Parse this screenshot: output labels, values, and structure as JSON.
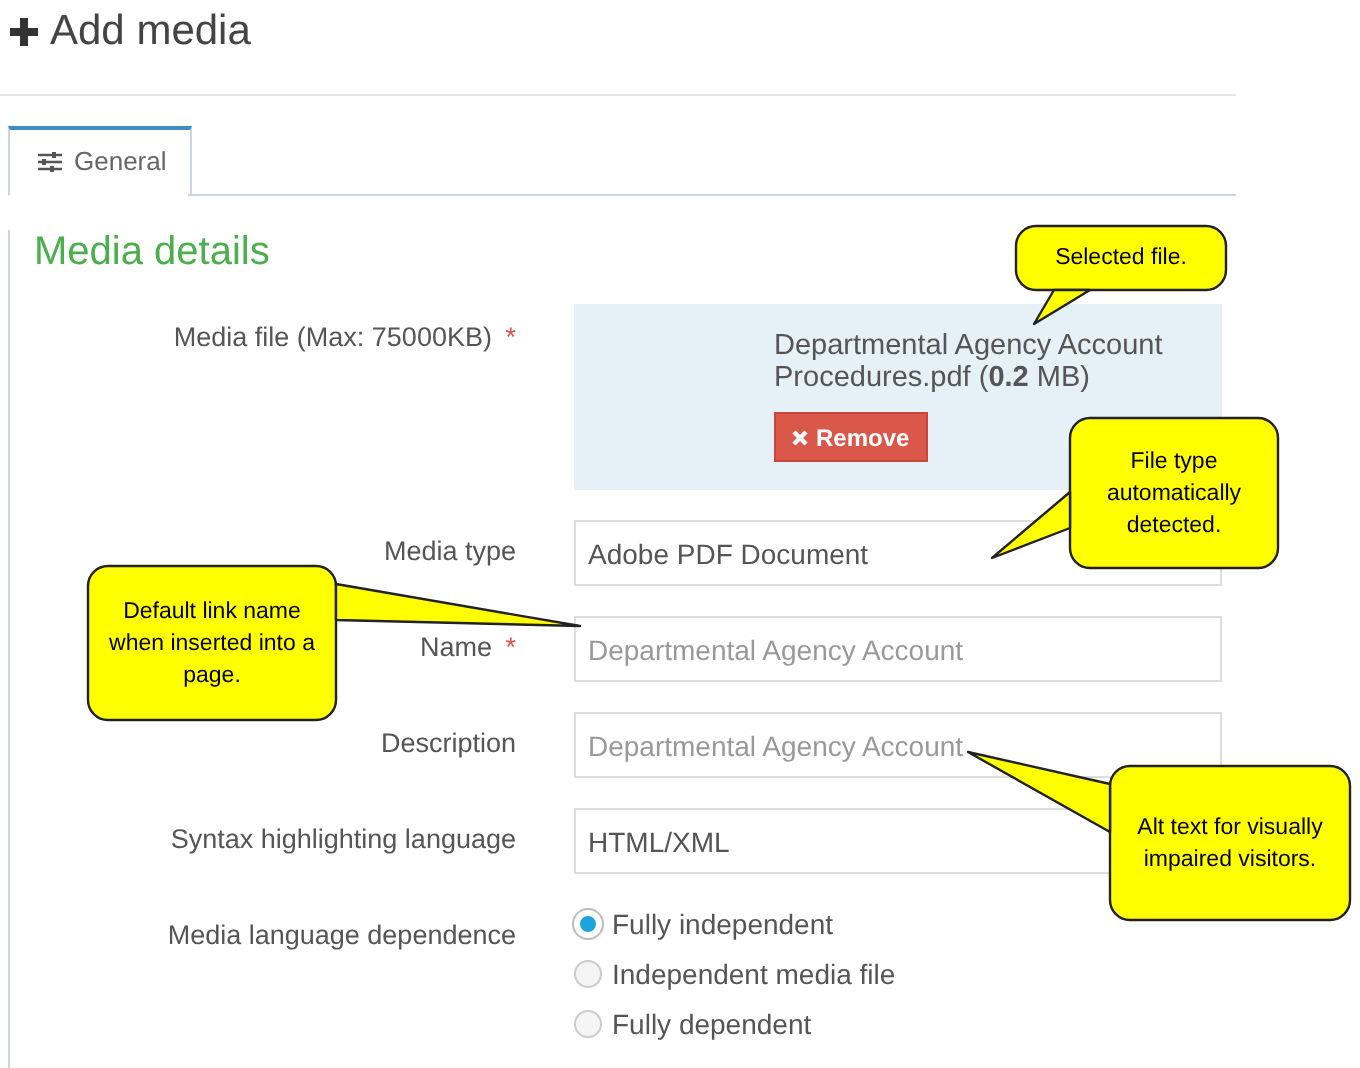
{
  "page_title": "Add media",
  "tabs": [
    {
      "label": "General",
      "selected": true
    }
  ],
  "section_title": "Media details",
  "fields": [
    {
      "kind": "file",
      "label": "Media file (Max: 75000KB)",
      "required_mark": "*",
      "file_name": "Departmental Agency Account Procedures.pdf (**0.2** MB)",
      "button": "Remove"
    },
    {
      "kind": "text",
      "label": "Media type",
      "value": "Adobe PDF Document"
    },
    {
      "kind": "text",
      "label": "Name",
      "required_mark": "*",
      "placeholder": "Departmental Agency Account"
    },
    {
      "kind": "text",
      "label": "Description",
      "placeholder": "Departmental Agency Account"
    },
    {
      "kind": "text",
      "label": "Syntax highlighting language",
      "value": "HTML/XML"
    },
    {
      "kind": "radio",
      "label": "Media language dependence",
      "options": [
        {
          "label": "Fully independent",
          "selected": true
        },
        {
          "label": "Independent media file",
          "selected": false
        },
        {
          "label": "Fully dependent",
          "selected": false
        }
      ]
    }
  ],
  "callouts": [
    {
      "text": "Selected file."
    },
    {
      "text": "File type automatically detected."
    },
    {
      "text": "Default link name when inserted into a page."
    },
    {
      "text": "Alt text for visually impaired visitors."
    }
  ]
}
